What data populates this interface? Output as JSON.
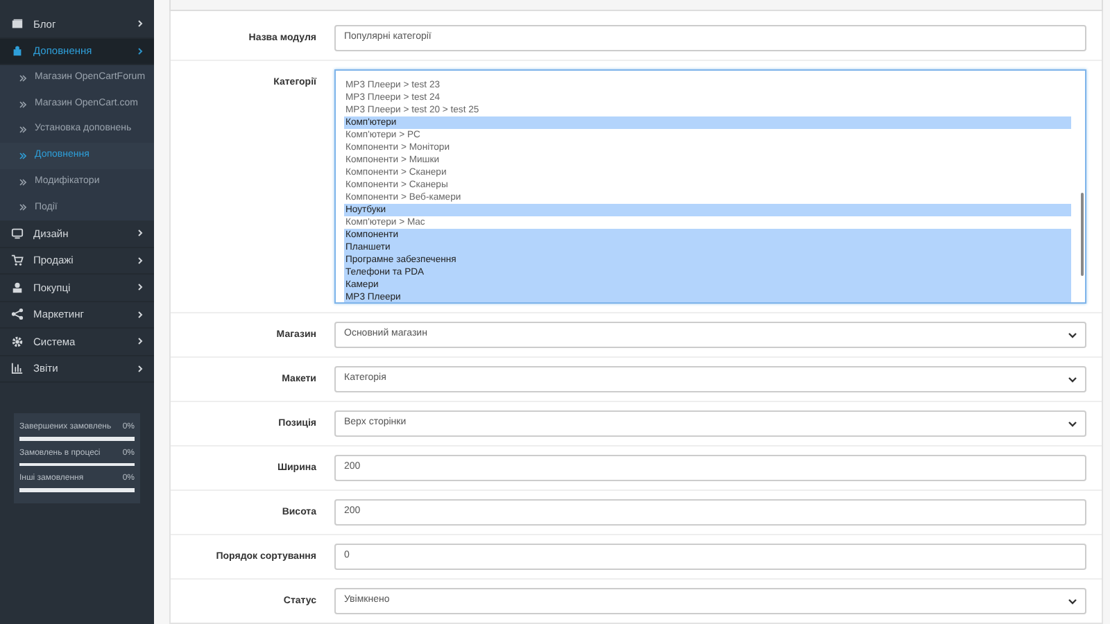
{
  "sidebar": {
    "items": [
      {
        "label": "Блог",
        "expanded": false,
        "selected": false
      },
      {
        "label": "Доповнення",
        "expanded": true,
        "selected": true,
        "children": [
          {
            "label": "Магазин OpenCartForum",
            "selected": false
          },
          {
            "label": "Магазин OpenCart.com",
            "selected": false
          },
          {
            "label": "Установка доповнень",
            "selected": false
          },
          {
            "label": "Доповнення",
            "selected": true
          },
          {
            "label": "Модифікатори",
            "selected": false
          },
          {
            "label": "Події",
            "selected": false
          }
        ]
      },
      {
        "label": "Дизайн",
        "expanded": false,
        "selected": false
      },
      {
        "label": "Продажі",
        "expanded": false,
        "selected": false
      },
      {
        "label": "Покупці",
        "expanded": false,
        "selected": false
      },
      {
        "label": "Маркетинг",
        "expanded": false,
        "selected": false
      },
      {
        "label": "Система",
        "expanded": false,
        "selected": false
      },
      {
        "label": "Звіти",
        "expanded": false,
        "selected": false
      }
    ],
    "stats": [
      {
        "label": "Завершених замовлень",
        "value": "0%",
        "level": 0
      },
      {
        "label": "Замовлень в процесі",
        "value": "0%",
        "level": 0
      },
      {
        "label": "Інші замовлення",
        "value": "0%",
        "level": 0
      }
    ]
  },
  "form": {
    "rows": [
      {
        "label": "Назва модуля",
        "kind": "text",
        "value": "Популярні категорії"
      },
      {
        "label": "Категорії",
        "kind": "multiselect",
        "options": [
          {
            "label": "MP3 Плеери  >  test 23",
            "selected": false
          },
          {
            "label": "MP3 Плеери  >  test 24",
            "selected": false
          },
          {
            "label": "MP3 Плеери  >  test 20  >  test 25",
            "selected": false
          },
          {
            "label": "Комп'ютери",
            "selected": true
          },
          {
            "label": "Комп'ютери  >  PC",
            "selected": false
          },
          {
            "label": "Компоненти  >  Монітори",
            "selected": false
          },
          {
            "label": "Компоненти  >  Мишки",
            "selected": false
          },
          {
            "label": "Компоненти  >  Сканери",
            "selected": false
          },
          {
            "label": "Компоненти  >  Сканеры",
            "selected": false
          },
          {
            "label": "Компоненти  >  Веб-камери",
            "selected": false
          },
          {
            "label": "Ноутбуки",
            "selected": true
          },
          {
            "label": "Комп'ютери  >  Mac",
            "selected": false
          },
          {
            "label": "Компоненти",
            "selected": true
          },
          {
            "label": "Планшети",
            "selected": true
          },
          {
            "label": "Програмне забезпечення",
            "selected": true
          },
          {
            "label": "Телефони та PDA",
            "selected": true
          },
          {
            "label": "Камери",
            "selected": true
          },
          {
            "label": "MP3 Плеери",
            "selected": true
          }
        ]
      },
      {
        "label": "Магазин",
        "kind": "select",
        "value": "Основний магазин"
      },
      {
        "label": "Макети",
        "kind": "select",
        "value": "Категорія"
      },
      {
        "label": "Позиція",
        "kind": "select",
        "value": "Верх сторінки"
      },
      {
        "label": "Ширина",
        "kind": "text",
        "value": "200"
      },
      {
        "label": "Висота",
        "kind": "text",
        "value": "200"
      },
      {
        "label": "Порядок сортування",
        "kind": "text",
        "value": "0"
      },
      {
        "label": "Статус",
        "kind": "select",
        "value": "Увімкнено"
      }
    ]
  }
}
